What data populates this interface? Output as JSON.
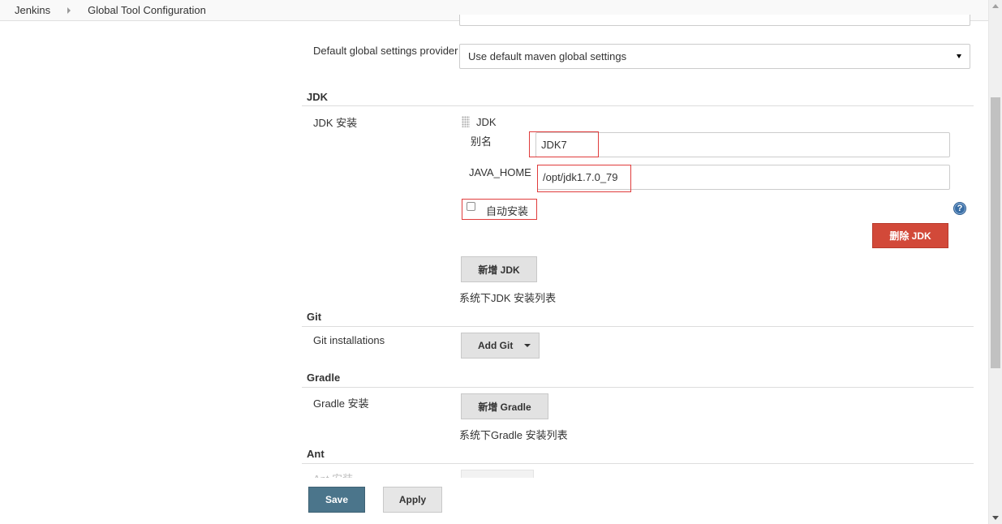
{
  "breadcrumb": {
    "items": [
      "Jenkins",
      "Global Tool Configuration"
    ]
  },
  "maven": {
    "global_settings_label": "Default global settings provider",
    "global_settings_value": "Use default maven global settings"
  },
  "jdk": {
    "section_title": "JDK",
    "install_label": "JDK 安装",
    "item_header": "JDK",
    "alias_label": "别名",
    "alias_value": "JDK7",
    "java_home_label": "JAVA_HOME",
    "java_home_value": "/opt/jdk1.7.0_79",
    "auto_install_label": "自动安装",
    "help_glyph": "?",
    "delete_button": "删除 JDK",
    "add_button": "新增 JDK",
    "list_caption": "系统下JDK 安装列表"
  },
  "git": {
    "section_title": "Git",
    "install_label": "Git installations",
    "add_button": "Add Git"
  },
  "gradle": {
    "section_title": "Gradle",
    "install_label": "Gradle 安装",
    "add_button": "新增 Gradle",
    "list_caption": "系统下Gradle 安装列表"
  },
  "ant": {
    "section_title": "Ant",
    "install_label": "Ant 安装"
  },
  "footer": {
    "save_button": "Save",
    "apply_button": "Apply"
  },
  "colors": {
    "save_bg": "#4b758b",
    "delete_bg": "#d24939",
    "highlight_outline": "#e03c3c"
  }
}
